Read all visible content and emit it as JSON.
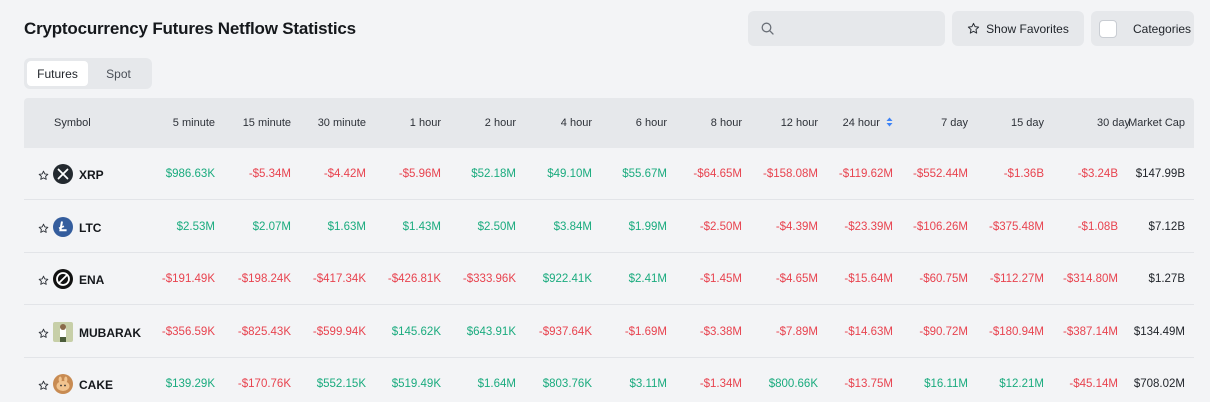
{
  "page": {
    "title": "Cryptocurrency Futures Netflow Statistics"
  },
  "toolbar": {
    "search_placeholder": "",
    "show_favorites_label": "Show Favorites",
    "categories_label": "Categories"
  },
  "tabs": [
    {
      "label": "Futures",
      "active": true
    },
    {
      "label": "Spot",
      "active": false
    }
  ],
  "table": {
    "columns": [
      "Symbol",
      "5 minute",
      "15 minute",
      "30 minute",
      "1 hour",
      "2 hour",
      "4 hour",
      "6 hour",
      "8 hour",
      "12 hour",
      "24 hour",
      "7 day",
      "15 day",
      "30 day",
      "Market Cap"
    ],
    "sorted_column": "24 hour",
    "rows": [
      {
        "symbol": "XRP",
        "icon": "xrp-icon",
        "values": [
          "$986.63K",
          "-$5.34M",
          "-$4.42M",
          "-$5.96M",
          "$52.18M",
          "$49.10M",
          "$55.67M",
          "-$64.65M",
          "-$158.08M",
          "-$119.62M",
          "-$552.44M",
          "-$1.36B",
          "-$3.24B",
          "$147.99B"
        ]
      },
      {
        "symbol": "LTC",
        "icon": "ltc-icon",
        "values": [
          "$2.53M",
          "$2.07M",
          "$1.63M",
          "$1.43M",
          "$2.50M",
          "$3.84M",
          "$1.99M",
          "-$2.50M",
          "-$4.39M",
          "-$23.39M",
          "-$106.26M",
          "-$375.48M",
          "-$1.08B",
          "$7.12B"
        ]
      },
      {
        "symbol": "ENA",
        "icon": "ena-icon",
        "values": [
          "-$191.49K",
          "-$198.24K",
          "-$417.34K",
          "-$426.81K",
          "-$333.96K",
          "$922.41K",
          "$2.41M",
          "-$1.45M",
          "-$4.65M",
          "-$15.64M",
          "-$60.75M",
          "-$112.27M",
          "-$314.80M",
          "$1.27B"
        ]
      },
      {
        "symbol": "MUBARAK",
        "icon": "mubarak-icon",
        "values": [
          "-$356.59K",
          "-$825.43K",
          "-$599.94K",
          "$145.62K",
          "$643.91K",
          "-$937.64K",
          "-$1.69M",
          "-$3.38M",
          "-$7.89M",
          "-$14.63M",
          "-$90.72M",
          "-$180.94M",
          "-$387.14M",
          "$134.49M"
        ]
      },
      {
        "symbol": "CAKE",
        "icon": "cake-icon",
        "values": [
          "$139.29K",
          "-$170.76K",
          "$552.15K",
          "$519.49K",
          "$1.64M",
          "$803.76K",
          "$3.11M",
          "-$1.34M",
          "$800.66K",
          "-$13.75M",
          "$16.11M",
          "$12.21M",
          "-$45.14M",
          "$708.02M"
        ]
      }
    ]
  },
  "colors": {
    "positive": "#1aab7e",
    "negative": "#e8434f"
  }
}
